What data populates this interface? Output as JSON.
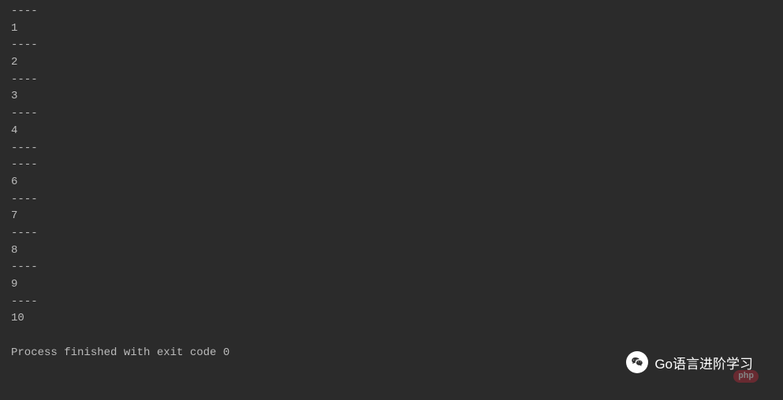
{
  "terminal": {
    "lines": [
      "----",
      "1",
      "----",
      "2",
      "----",
      "3",
      "----",
      "4",
      "----",
      "----",
      "6",
      "----",
      "7",
      "----",
      "8",
      "----",
      "9",
      "----",
      "10",
      "",
      "Process finished with exit code 0"
    ]
  },
  "watermarks": {
    "php_badge": "php",
    "php_text": "",
    "wechat_label": "Go语言进阶学习"
  }
}
